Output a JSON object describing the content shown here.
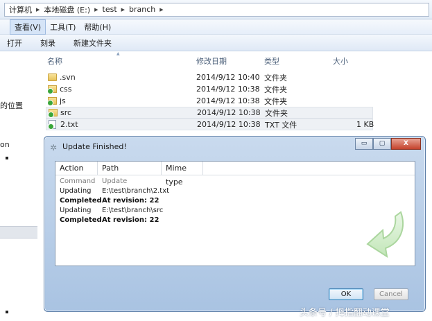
{
  "explorer": {
    "breadcrumb": [
      "计算机",
      "本地磁盘 (E:)",
      "test",
      "branch"
    ],
    "menu": [
      "查看(V)",
      "工具(T)",
      "帮助(H)"
    ],
    "toolbar": [
      "打开",
      "刻录",
      "新建文件夹"
    ],
    "nav_labels": [
      "的位置",
      "on"
    ],
    "columns": [
      "名称",
      "修改日期",
      "类型",
      "大小"
    ],
    "files": [
      {
        "name": ".svn",
        "date": "2014/9/12 10:40",
        "type": "文件夹",
        "size": "",
        "icon": "folder-icon"
      },
      {
        "name": "css",
        "date": "2014/9/12 10:38",
        "type": "文件夹",
        "size": "",
        "icon": "svn-folder-icon"
      },
      {
        "name": "js",
        "date": "2014/9/12 10:38",
        "type": "文件夹",
        "size": "",
        "icon": "svn-folder-icon"
      },
      {
        "name": "src",
        "date": "2014/9/12 10:38",
        "type": "文件夹",
        "size": "",
        "icon": "svn-folder-icon"
      },
      {
        "name": "2.txt",
        "date": "2014/9/12 10:38",
        "type": "TXT 文件",
        "size": "1 KB",
        "icon": "svn-text-file-icon"
      }
    ]
  },
  "dialog": {
    "title": "Update Finished!",
    "window_buttons": [
      "▭",
      "▢",
      "X"
    ],
    "columns": [
      "Action",
      "Path",
      "Mime type"
    ],
    "rows": [
      {
        "action": "Command",
        "path": "Update",
        "style": "gray"
      },
      {
        "action": "Updating",
        "path": "E:\\test\\branch\\2.txt",
        "style": "normal"
      },
      {
        "action": "Completed",
        "path": "At revision: 22",
        "style": "bold"
      },
      {
        "action": "Updating",
        "path": "E:\\test\\branch\\src",
        "style": "normal"
      },
      {
        "action": "Completed",
        "path": "At revision: 22",
        "style": "bold"
      }
    ],
    "ok_label": "OK",
    "cancel_label": "Cancel"
  },
  "watermark": "头条号 / 拇指翻动课堂",
  "colors": {
    "accent": "#3c7fb1",
    "svn_green": "#3aa63a",
    "dialog_frame": "#a9c3e2"
  }
}
